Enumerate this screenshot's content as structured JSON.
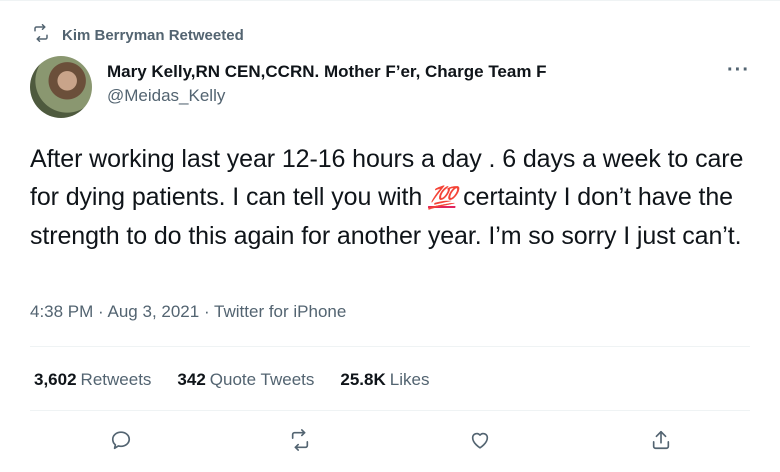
{
  "retweet": {
    "label": "Kim Berryman Retweeted",
    "icon": "retweet-icon"
  },
  "author": {
    "name": "Mary Kelly,RN CEN,CCRN. Mother F’er, Charge Team F",
    "handle": "@Meidas_Kelly"
  },
  "tweet": {
    "text_part1": "After working last year 12-16 hours a day . 6 days a week to care for dying patients. I can tell you with ",
    "emoji": "💯",
    "text_part2": " certainty I don’t have the strength to do this again for another year. I’m so sorry I just can’t."
  },
  "meta": {
    "time": "4:38 PM",
    "date": "Aug 3, 2021",
    "source": "Twitter for iPhone",
    "separator": "·"
  },
  "stats": {
    "retweets_count": "3,602",
    "retweets_label": "Retweets",
    "quotes_count": "342",
    "quotes_label": "Quote Tweets",
    "likes_count": "25.8K",
    "likes_label": "Likes"
  },
  "more_label": "···",
  "colors": {
    "text": "#0f1419",
    "muted": "#536471",
    "divider": "#eff3f4",
    "emoji": "#e0245e"
  }
}
